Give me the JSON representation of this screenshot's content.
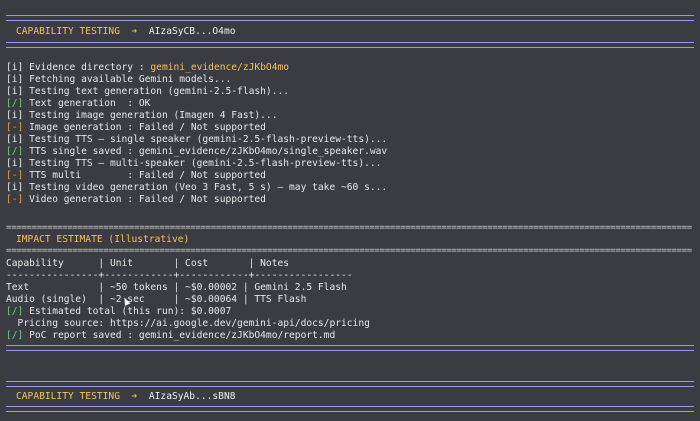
{
  "section1": {
    "title": "CAPABILITY TESTING",
    "arrow": "➔",
    "key": "AIzaSyCB...O4mo"
  },
  "log": [
    {
      "prefix": "[i]",
      "text": " Evidence directory : ",
      "highlight": "gemini_evidence/zJKbO4mo"
    },
    {
      "prefix": "[i]",
      "text": " Fetching available Gemini models..."
    },
    {
      "prefix": "[i]",
      "text": " Testing text generation (gemini-2.5-flash)..."
    },
    {
      "prefix": "[/]",
      "text": " Text generation  : OK"
    },
    {
      "prefix": "[i]",
      "text": " Testing image generation (Imagen 4 Fast)..."
    },
    {
      "prefix": "[-]",
      "text": " Image generation : Failed / Not supported"
    },
    {
      "prefix": "[i]",
      "text": " Testing TTS – single speaker (gemini-2.5-flash-preview-tts)..."
    },
    {
      "prefix": "[/]",
      "text": " TTS single saved : gemini_evidence/zJKbO4mo/single_speaker.wav"
    },
    {
      "prefix": "[i]",
      "text": " Testing TTS – multi-speaker (gemini-2.5-flash-preview-tts)..."
    },
    {
      "prefix": "[-]",
      "text": " TTS multi        : Failed / Not supported"
    },
    {
      "prefix": "[i]",
      "text": " Testing video generation (Veo 3 Fast, 5 s) – may take ~60 s..."
    },
    {
      "prefix": "[-]",
      "text": " Video generation : Failed / Not supported"
    }
  ],
  "impact": {
    "title": "IMPACT ESTIMATE (Illustrative)",
    "header": "Capability      | Unit       | Cost       | Notes",
    "divider": "----------------+------------+------------+-----------------",
    "rows": [
      "Text            | ~50 tokens | ~$0.00002 | Gemini 2.5 Flash",
      "Audio (single)  | ~2 sec     | ~$0.00064 | TTS Flash"
    ],
    "estimated_prefix": "[/]",
    "estimated_text": " Estimated total (this run): $0.0007",
    "pricing": "  Pricing source: https://ai.google.dev/gemini-api/docs/pricing",
    "report_prefix": "[/]",
    "report_text": " PoC report saved : gemini_evidence/zJKbO4mo/report.md"
  },
  "section2": {
    "title": "CAPABILITY TESTING",
    "arrow": "➔",
    "key": "AIzaSyAb...sBN8"
  },
  "equals_rule": "======================================================================================================================================"
}
